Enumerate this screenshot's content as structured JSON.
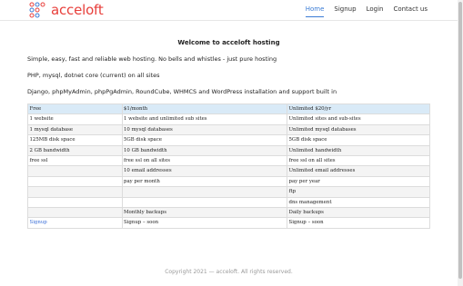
{
  "brand": {
    "name": "acceloft"
  },
  "nav": {
    "items": [
      {
        "label": "Home",
        "active": true
      },
      {
        "label": "Signup",
        "active": false
      },
      {
        "label": "Login",
        "active": false
      },
      {
        "label": "Contact us",
        "active": false
      }
    ]
  },
  "main": {
    "heading": "Welcome to acceloft hosting",
    "paragraphs": [
      "Simple, easy, fast and reliable web hosting. No bells and whistles - just pure hosting",
      "PHP, mysql, dotnet core (current) on all sites",
      "Django, phpMyAdmin, phpPgAdmin, RoundCube, WHMCS and WordPress installation and support built in"
    ]
  },
  "table": {
    "headers": [
      "Free",
      "$1/month",
      "Unlimited $20/yr"
    ],
    "rows": [
      [
        "1 website",
        "1 website and unlimited sub sites",
        "Unlimited sites and sub-sites"
      ],
      [
        "1 mysql database",
        "10 mysql databases",
        "Unlimited mysql databases"
      ],
      [
        "125MB disk space",
        "5GB disk space",
        "5GB disk space"
      ],
      [
        "2 GB bandwidth",
        "10 GB bandwidth",
        "Unlimited handwidth"
      ],
      [
        "free ssl",
        "free ssl on all sites",
        "free ssl on all sites"
      ],
      [
        "",
        "10 email addresses",
        "Unlimited email addresses"
      ],
      [
        "",
        "pay per month",
        "pay per year"
      ],
      [
        "",
        "",
        "ftp"
      ],
      [
        "",
        "",
        "dns management"
      ],
      [
        "",
        "Monthly backups",
        "Daily backups"
      ],
      [
        "Signup",
        "Signup – soon",
        "Signup – soon"
      ]
    ]
  },
  "footer": {
    "text": "Copyright 2021 — acceloft. All rights reserved."
  },
  "colors": {
    "brand": "#e8403c",
    "accent": "#3a7bd5",
    "table_header": "#d9eaf7",
    "link": "#3a6fd8"
  },
  "icons": {
    "logo": "dots-cluster-logo"
  }
}
